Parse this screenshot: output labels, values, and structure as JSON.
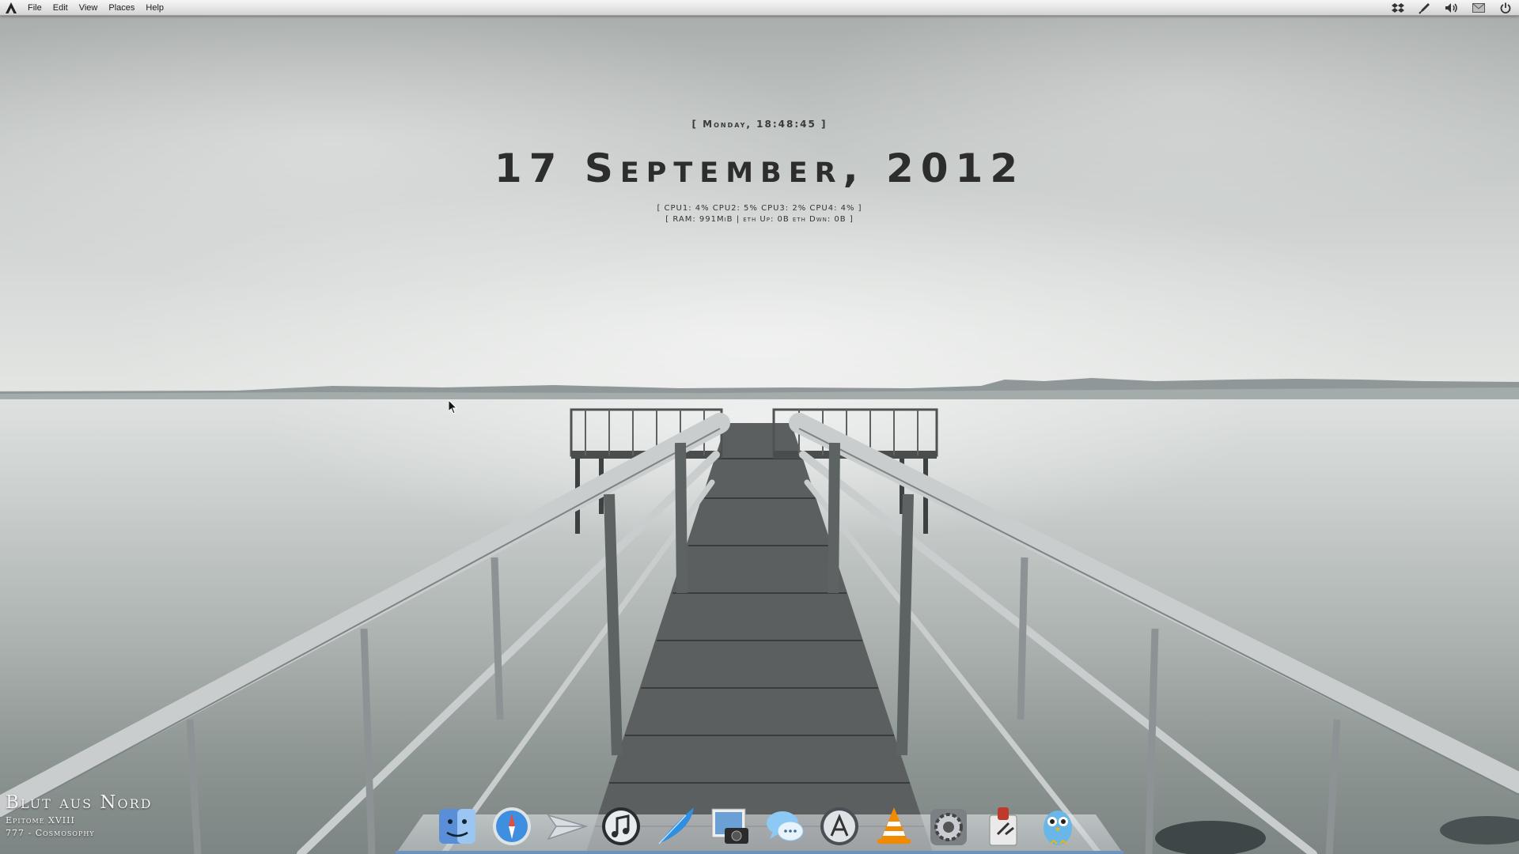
{
  "topbar": {
    "logo_icon": "arch-logo-icon",
    "menu": [
      "File",
      "Edit",
      "View",
      "Places",
      "Help"
    ],
    "tray_icons": [
      "dropbox-icon",
      "pen-icon",
      "volume-icon",
      "mail-icon",
      "power-icon"
    ]
  },
  "conky": {
    "day_time": "[ Monday, 18:48:45 ]",
    "date": "17 September, 2012",
    "cpu_line": "[ CPU1: 4% CPU2: 5% CPU3: 2% CPU4: 4% ]",
    "ram_line": "[ RAM: 991MiB | eth Up: 0B   eth Dwn: 0B   ]"
  },
  "now_playing": {
    "artist": "Blut aus Nord",
    "album": "Epitome XVIII",
    "track": "777 - Cosmosophy"
  },
  "dock": {
    "items": [
      "finder-icon",
      "safari-icon",
      "mail-plane-icon",
      "itunes-icon",
      "quill-icon",
      "iphoto-icon",
      "messages-icon",
      "app-store-icon",
      "vlc-icon",
      "system-preferences-icon",
      "automator-icon",
      "twitter-owl-icon"
    ]
  },
  "colors": {
    "panel": "#e4e4e4",
    "dock_accent": "#6f93bf",
    "clock_text": "#2d2d2d"
  }
}
